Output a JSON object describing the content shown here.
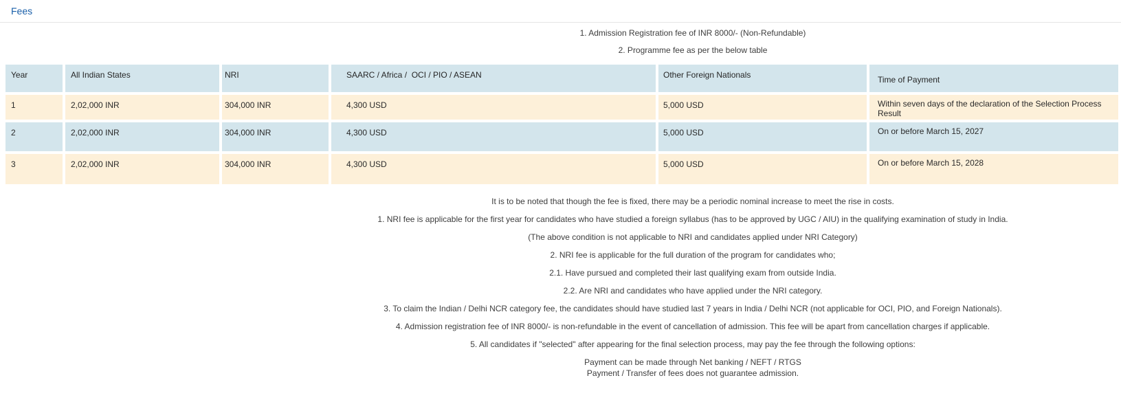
{
  "colors": {
    "accent": "#1a5fa9",
    "header_bg": "#d3e5ec",
    "row_alt_bg": "#fdf0d9"
  },
  "page": {
    "title": "Fees"
  },
  "intro": {
    "line1": "1. Admission Registration fee of INR 8000/- (Non-Refundable)",
    "line2": "2. Programme fee as per the below table"
  },
  "table": {
    "headers": [
      "Year",
      "All Indian States",
      "NRI",
      "SAARC / Africa /  OCI / PIO / ASEAN",
      "Other Foreign Nationals",
      "Time of Payment"
    ],
    "rows": [
      {
        "year": "1",
        "all_indian_states": "2,02,000 INR",
        "nri": "304,000 INR",
        "saarc_africa_oci_pio_asean": "4,300 USD",
        "other_foreign_nationals": "5,000 USD",
        "time_of_payment": "Within seven days of the declaration of the Selection Process Result"
      },
      {
        "year": "2",
        "all_indian_states": "2,02,000 INR",
        "nri": "304,000 INR",
        "saarc_africa_oci_pio_asean": "4,300 USD",
        "other_foreign_nationals": "5,000 USD",
        "time_of_payment": "On or before March 15, 2027"
      },
      {
        "year": "3",
        "all_indian_states": "2,02,000 INR",
        "nri": "304,000 INR",
        "saarc_africa_oci_pio_asean": "4,300 USD",
        "other_foreign_nationals": "5,000 USD",
        "time_of_payment": "On or before March 15, 2028"
      }
    ]
  },
  "notes": [
    "It is to be noted that though the fee is fixed, there may be a periodic nominal increase to meet the rise in costs.",
    "1. NRI fee is applicable for the first year for candidates who have studied a foreign syllabus (has to be approved by UGC / AIU) in the qualifying examination of study in India.",
    "(The above condition is not applicable to NRI and candidates applied under NRI Category)",
    "2. NRI fee is applicable for the full duration of the program for candidates who;",
    "2.1. Have pursued and completed their last qualifying exam from outside India.",
    "2.2. Are NRI and candidates who have applied under the NRI category.",
    "3. To claim the Indian / Delhi NCR category fee, the candidates should have studied last 7 years in India / Delhi NCR (not applicable for OCI, PIO, and Foreign Nationals).",
    "4. Admission registration fee of INR 8000/- is non-refundable in the event of cancellation of admission. This fee will be apart from cancellation charges if applicable.",
    "5. All candidates if \"selected\" after appearing for the final selection process, may pay the fee through the following options:",
    "Payment can be made through Net banking / NEFT / RTGS",
    "Payment / Transfer of fees does not guarantee admission."
  ]
}
